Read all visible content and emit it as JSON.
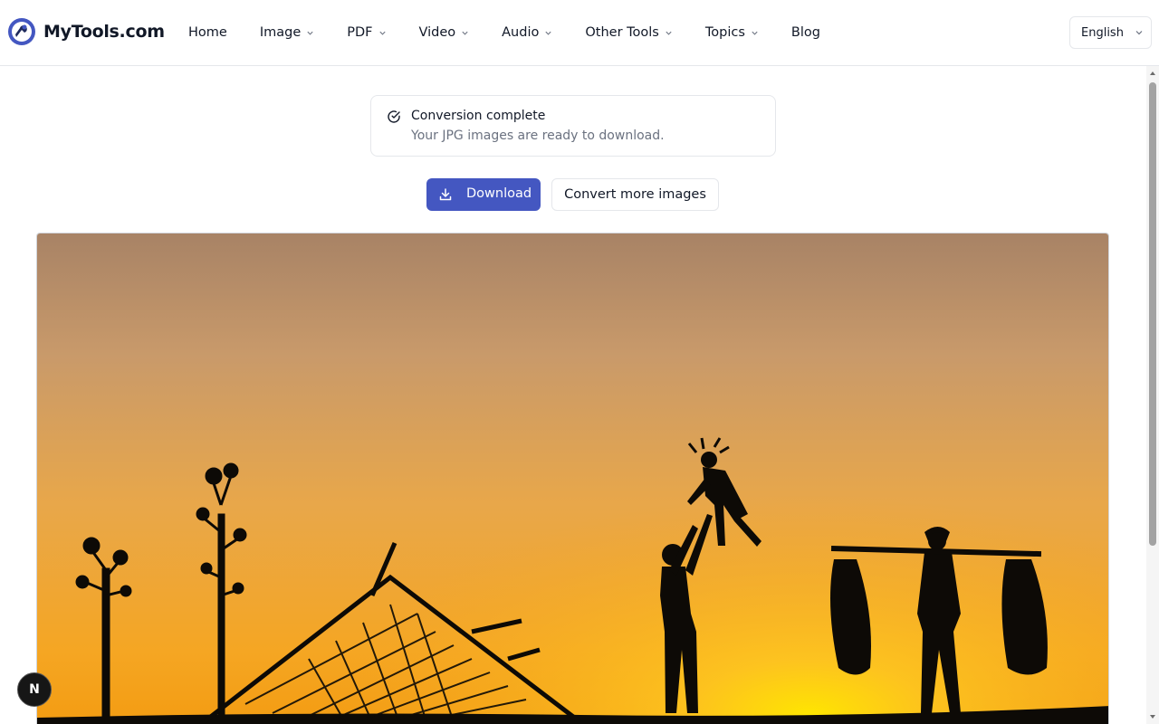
{
  "brand": {
    "name": "MyTools.com",
    "accent": "#4457c1"
  },
  "nav": {
    "items": [
      {
        "label": "Home",
        "has_dropdown": false
      },
      {
        "label": "Image",
        "has_dropdown": true
      },
      {
        "label": "PDF",
        "has_dropdown": true
      },
      {
        "label": "Video",
        "has_dropdown": true
      },
      {
        "label": "Audio",
        "has_dropdown": true
      },
      {
        "label": "Other Tools",
        "has_dropdown": true
      },
      {
        "label": "Topics",
        "has_dropdown": true
      },
      {
        "label": "Blog",
        "has_dropdown": false
      }
    ]
  },
  "language": {
    "selected": "English"
  },
  "alert": {
    "title": "Conversion complete",
    "description": "Your JPG images are ready to download.",
    "icon": "check-circle-icon"
  },
  "actions": {
    "download_label": "Download",
    "convert_more_label": "Convert more images"
  },
  "preview": {
    "description_icon": "image-preview"
  },
  "floating_badge": {
    "label": "N"
  }
}
